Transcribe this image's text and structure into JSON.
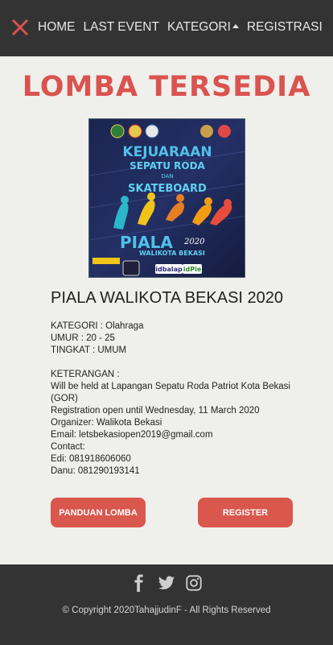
{
  "nav": {
    "items": [
      {
        "label": "HOME"
      },
      {
        "label": "LAST EVENT"
      },
      {
        "label": "KATEGORI"
      },
      {
        "label": "REGISTRASI"
      }
    ]
  },
  "main": {
    "title": "LOMBA TERSEDIA",
    "poster": {
      "headline": "KEJUARAAN",
      "subline": "SEPATU RODA",
      "and": "DAN",
      "subline2": "SKATEBOARD",
      "piala": "PIALA",
      "year": "2020",
      "city": "WALIKOTA BEKASI",
      "sponsor1": "idbalap",
      "sponsor2": "idPie"
    },
    "event_title": "PIALA WALIKOTA BEKASI 2020",
    "details": {
      "kategori": "KATEGORI : Olahraga",
      "umur": "UMUR : 20 - 25",
      "tingkat": "TINGKAT : UMUM",
      "keterangan": "KETERANGAN :",
      "held": "Will be held at Lapangan Sepatu Roda Patriot Kota Bekasi (GOR)",
      "registration": "Registration open until Wednesday, 11 March 2020",
      "organizer": "Organizer: Walikota Bekasi",
      "email": "Email: letsbekasiopen2019@gmail.com",
      "contact": "Contact:",
      "edi": "Edi: 081918606060",
      "danu": "Danu: 081290193141"
    },
    "buttons": {
      "guide": "PANDUAN LOMBA",
      "register": "REGISTER"
    }
  },
  "footer": {
    "icons": [
      "facebook-icon",
      "twitter-icon",
      "instagram-icon"
    ],
    "copyright": "© Copyright 2020TahajjudinF - All Rights Reserved"
  },
  "colors": {
    "accent": "#d9534f",
    "nav_bg": "#333333",
    "page_bg": "#efefeb"
  }
}
